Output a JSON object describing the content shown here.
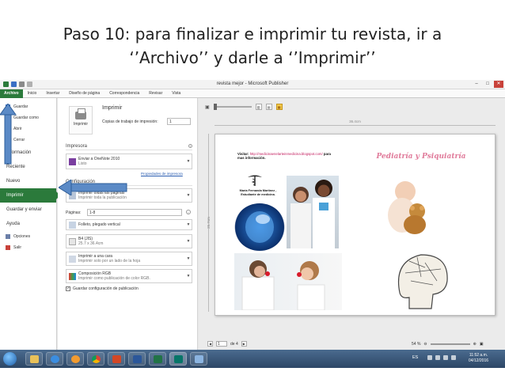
{
  "slide": {
    "title_line1": "Paso 10: para finalizar e imprimir tu revista, ir a",
    "title_line2": "‘’Archivo’’ y darle a ‘’Imprimir’’"
  },
  "window": {
    "title": "revista mejor - Microsoft Publisher",
    "minimize": "–",
    "maximize": "□",
    "close": "✕"
  },
  "ribbon": {
    "tabs": [
      "Archivo",
      "Inicio",
      "Insertar",
      "Diseño de página",
      "Correspondencia",
      "Revisar",
      "Vista"
    ]
  },
  "nav": {
    "small_items": [
      {
        "label": "Guardar",
        "icon": "save-icon",
        "color": "#3a6fc4"
      },
      {
        "label": "Guardar como",
        "icon": "save-as-icon",
        "color": "#3a6fc4"
      },
      {
        "label": "Abrir",
        "icon": "open-icon",
        "color": "#e1b34a"
      },
      {
        "label": "Cerrar",
        "icon": "close-file-icon",
        "color": "#888888"
      }
    ],
    "big_items": [
      "Información",
      "Reciente",
      "Nuevo",
      "Imprimir",
      "Guardar y enviar",
      "Ayuda"
    ],
    "bottom_items": [
      {
        "label": "Opciones",
        "icon": "options-icon",
        "color": "#6b7fa8"
      },
      {
        "label": "Salir",
        "icon": "exit-icon",
        "color": "#c8423a"
      }
    ]
  },
  "print": {
    "button_label": "Imprimir",
    "heading": "Imprimir",
    "copies_label": "Copias de trabajo de impresión:",
    "copies_value": "1",
    "printer_section": "Impresora",
    "printer_name": "Enviar a OneNote 2010",
    "printer_status": "Listo",
    "printer_props": "Propiedades de impresora",
    "settings_section": "Configuración",
    "print_all_main": "Imprimir todas las páginas",
    "print_all_sub": "Imprimir toda la publicación",
    "pages_label": "Páginas:",
    "pages_value": "1-8",
    "layout_main": "Folleto, plegado vertical",
    "paper_main": "B4 (JIS)",
    "paper_sub": "25.7 x 36.4cm",
    "sides_main": "Imprimir a una cara",
    "sides_sub": "Imprimir solo por un lado de la hoja",
    "color_main": "Composición RGB",
    "color_sub": "Imprimir como publicación de color RGB.",
    "save_settings": "Guardar configuración de publicación"
  },
  "preview": {
    "ruler_h": "36.4cm",
    "ruler_v": "25.7cm",
    "visit_label": "Visitar:",
    "visit_url": "http://medicinaenelarteinmedicina.blogspot.com/",
    "visit_more": "para mas información.",
    "author": "María Fernanda Martínez , Estudiante de medicina.",
    "headline": "Pediatría y Psiquiatría",
    "current_page": "1",
    "of_pages": "de 4",
    "zoom": "54 %"
  },
  "taskbar": {
    "lang": "ES",
    "time": "11:52 a.m.",
    "date": "04/12/2016"
  }
}
